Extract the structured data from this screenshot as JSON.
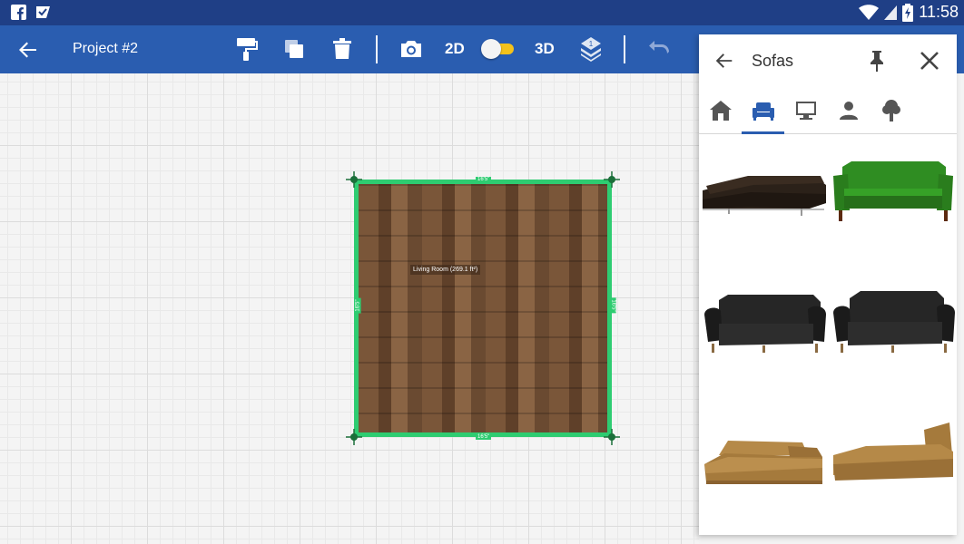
{
  "status_bar": {
    "time": "11:58",
    "left_icons": [
      "facebook-icon",
      "checkmark-flag-icon"
    ],
    "right_icons": [
      "wifi-icon",
      "signal-icon",
      "battery-charging-icon"
    ]
  },
  "toolbar": {
    "title": "Project #2",
    "mode_2d": "2D",
    "mode_3d": "3D",
    "layers_badge": "1",
    "icons": [
      "back-arrow-icon",
      "paint-roller-icon",
      "copy-icon",
      "delete-icon",
      "camera-icon",
      "layers-icon",
      "undo-icon"
    ]
  },
  "canvas": {
    "room_label": "Living Room (269.1 ft²)",
    "dim_top": "16'5\"",
    "dim_bottom": "16'5\"",
    "dim_left": "16'5\"",
    "dim_right": "16'5\""
  },
  "panel": {
    "title": "Sofas",
    "tabs": [
      "house-icon",
      "armchair-icon",
      "monitor-icon",
      "person-icon",
      "tree-icon"
    ],
    "active_tab": 1,
    "items": [
      {
        "name": "sectional-dark-brown-sofa",
        "color": "#2b2119"
      },
      {
        "name": "green-three-seat-sofa",
        "color": "#2f7d1f"
      },
      {
        "name": "black-classic-sofa-1",
        "color": "#1e1e1e"
      },
      {
        "name": "black-classic-sofa-2",
        "color": "#1e1e1e"
      },
      {
        "name": "tan-corner-sofa",
        "color": "#a57a3c"
      },
      {
        "name": "tan-chaise-lounge",
        "color": "#a57a3c"
      }
    ]
  },
  "colors": {
    "status_bar": "#1f3f86",
    "toolbar": "#2a5db0",
    "accent_toggle": "#f5c21a",
    "room_border": "#2ecc71"
  }
}
